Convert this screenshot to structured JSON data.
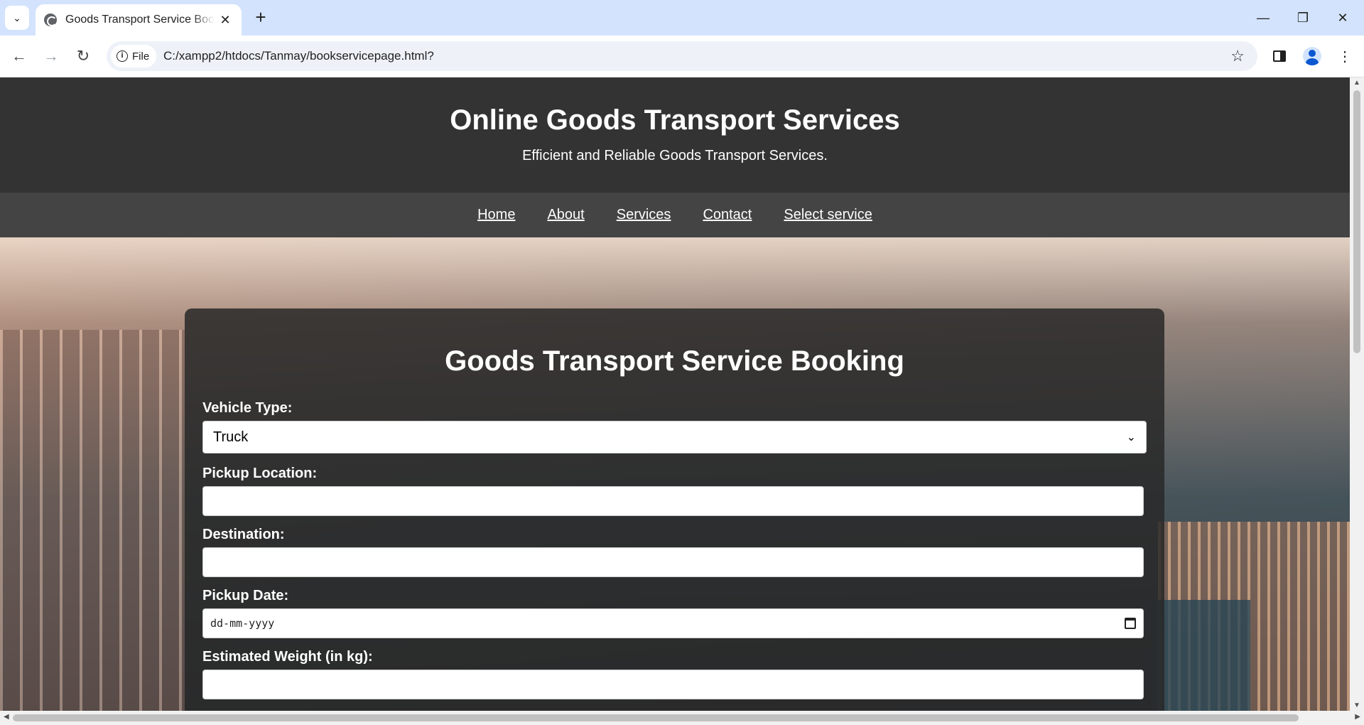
{
  "browser": {
    "tab_title": "Goods Transport Service Booking",
    "tab_close": "✕",
    "new_tab": "+",
    "site_chip": "File",
    "url": "C:/xampp2/htdocs/Tanmay/bookservicepage.html?",
    "window_controls": [
      "—",
      "❐",
      "✕"
    ]
  },
  "header": {
    "title": "Online Goods Transport Services",
    "subtitle": "Efficient and Reliable Goods Transport Services."
  },
  "nav": {
    "items": [
      "Home",
      "About",
      "Services",
      "Contact",
      "Select service"
    ]
  },
  "form": {
    "heading": "Goods Transport Service Booking",
    "vehicle_type_label": "Vehicle Type:",
    "vehicle_type_value": "Truck",
    "pickup_location_label": "Pickup Location:",
    "pickup_location_value": "",
    "destination_label": "Destination:",
    "destination_value": "",
    "pickup_date_label": "Pickup Date:",
    "pickup_date_placeholder": "dd-mm-yyyy",
    "weight_label": "Estimated Weight (in kg):",
    "weight_value": ""
  }
}
